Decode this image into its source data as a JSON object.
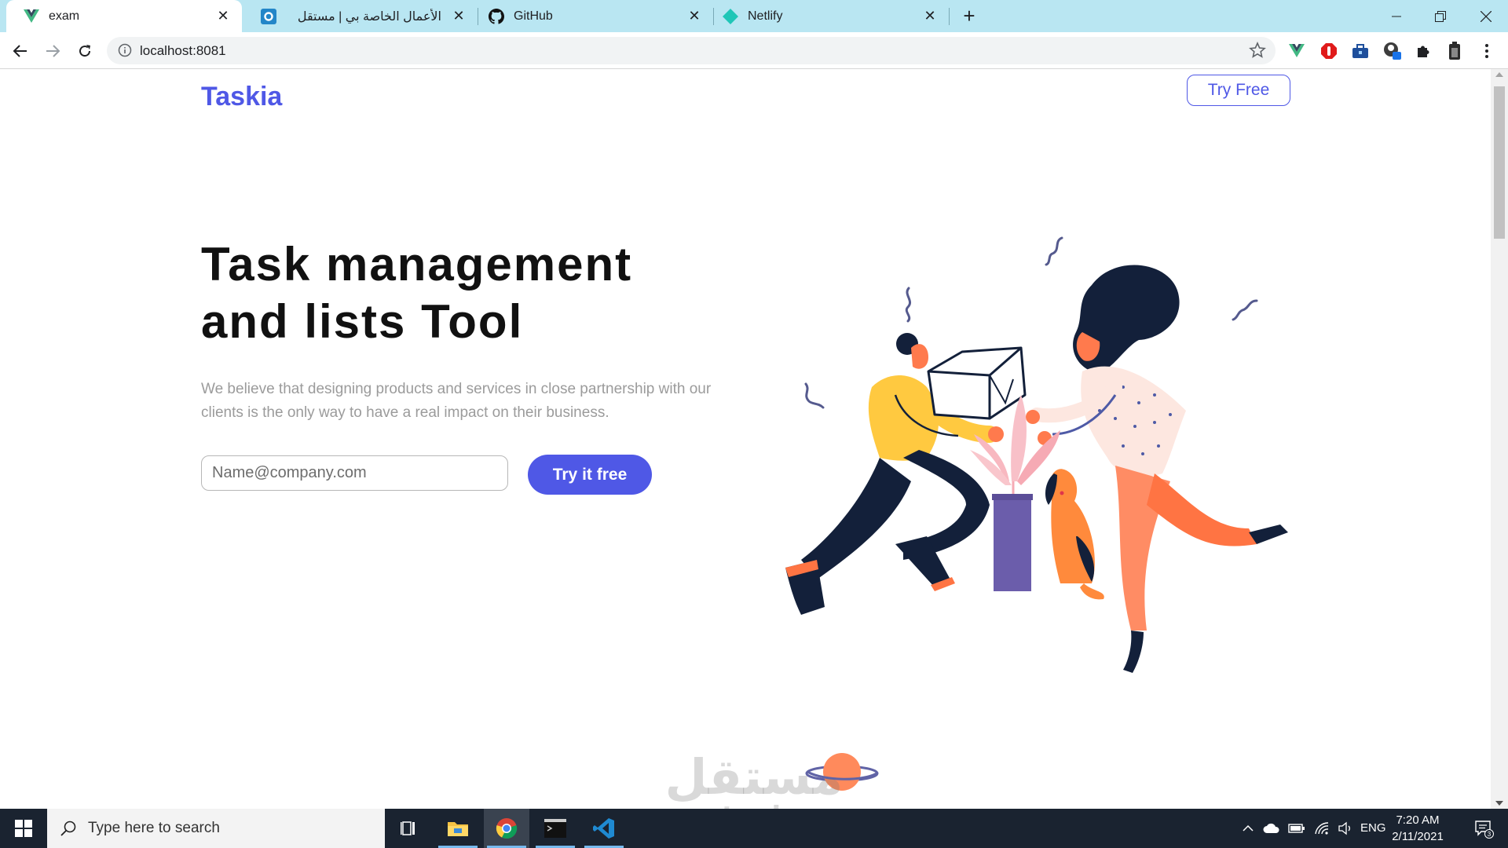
{
  "browser": {
    "tabs": [
      {
        "title": "exam",
        "icon": "vue-icon",
        "active": true
      },
      {
        "title": "الأعمال الخاصة بي | مستقل",
        "icon": "mostaql-icon",
        "active": false
      },
      {
        "title": "GitHub",
        "icon": "github-icon",
        "active": false
      },
      {
        "title": "Netlify",
        "icon": "netlify-icon",
        "active": false
      }
    ],
    "url": "localhost:8081"
  },
  "page": {
    "logo": "Taskia",
    "header_button": "Try Free",
    "hero_title": "Task management and lists Tool",
    "hero_description": "We believe that designing products and services in close partnership with our clients is the only way to have a real impact on their business.",
    "email_placeholder": "Name@company.com",
    "cta_button": "Try it free"
  },
  "watermark": {
    "arabic": "مستقل",
    "latin": "mostaql.com"
  },
  "taskbar": {
    "search_placeholder": "Type here to search",
    "language": "ENG",
    "time": "7:20 AM",
    "date": "2/11/2021",
    "notification_count": "3"
  },
  "colors": {
    "brand": "#4f58e6",
    "tabstrip": "#b9e6f2",
    "taskbar": "#1a2330"
  }
}
